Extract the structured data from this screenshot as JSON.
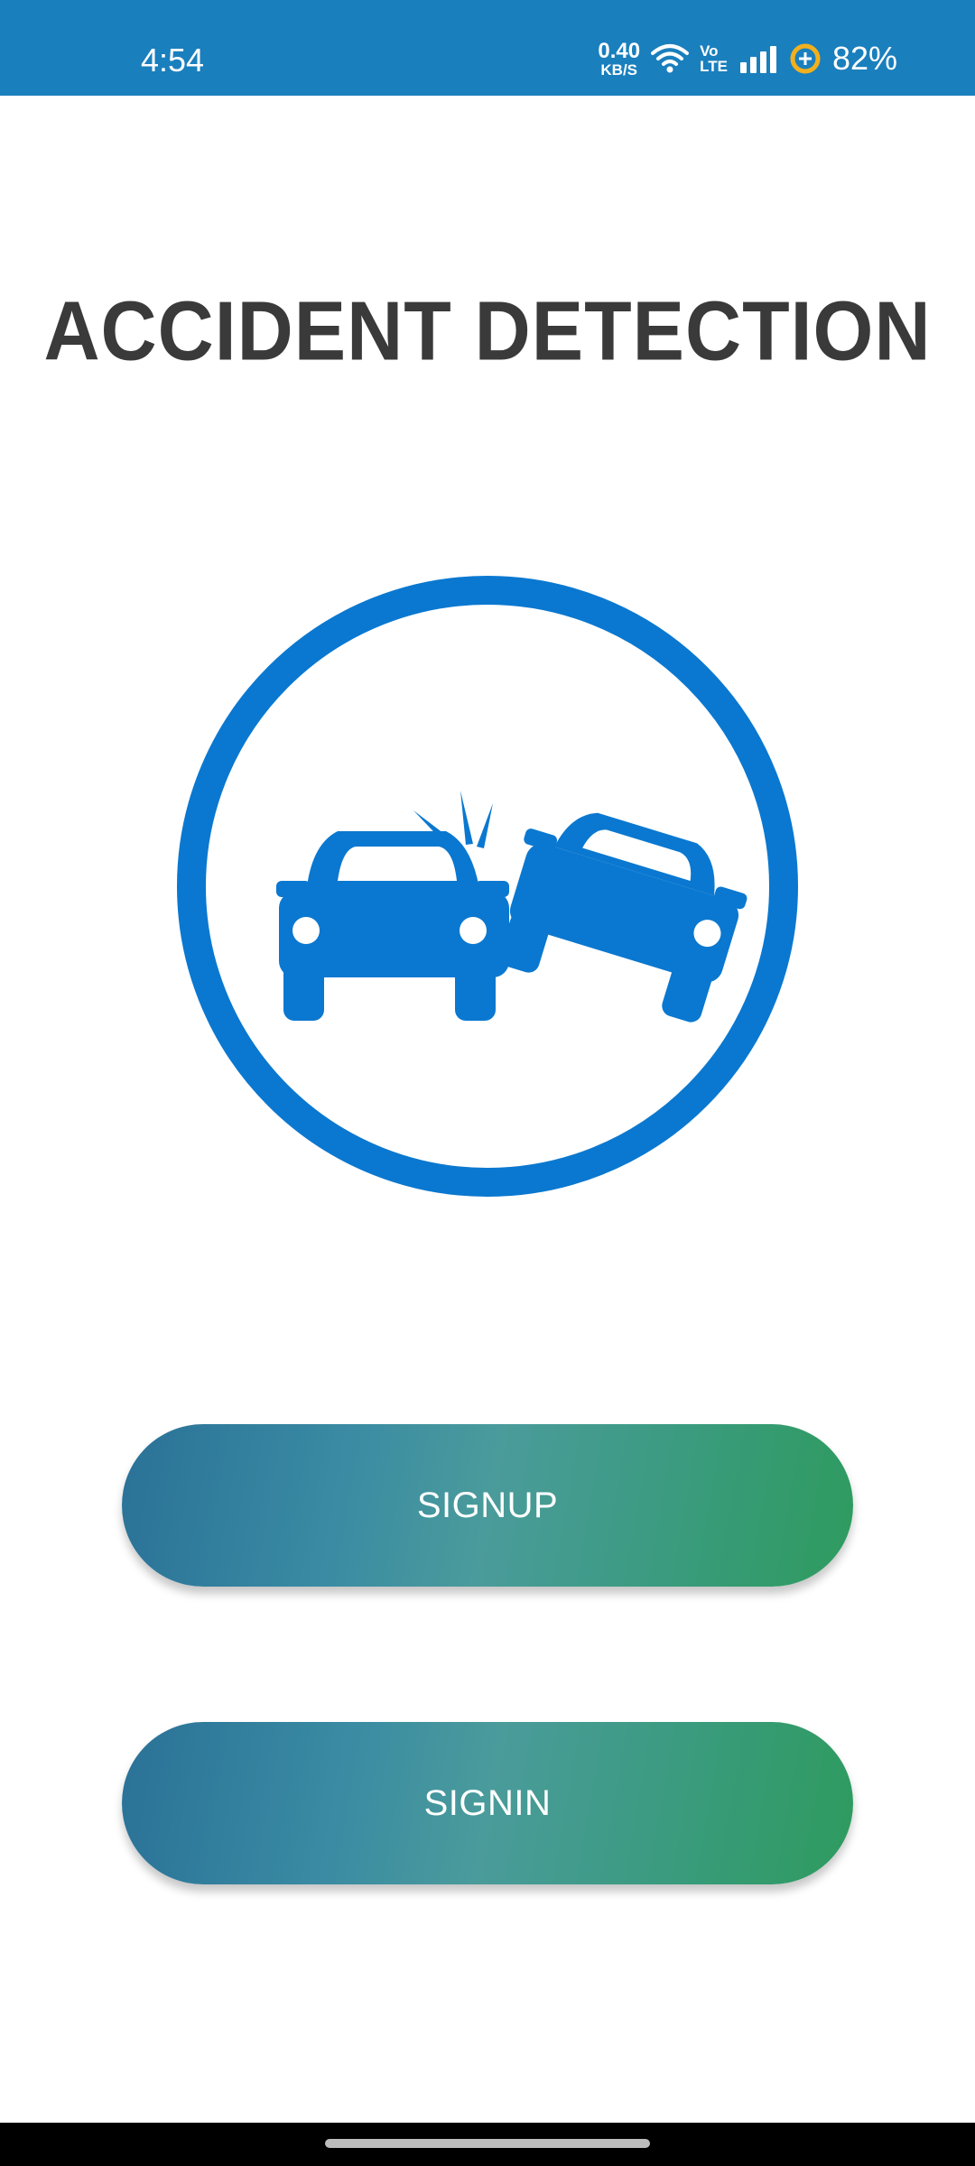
{
  "status_bar": {
    "time": "4:54",
    "net_speed_value": "0.40",
    "net_speed_unit": "KB/S",
    "volte_top": "Vo",
    "volte_bottom": "LTE",
    "battery": "82%"
  },
  "main": {
    "title": "ACCIDENT DETECTION",
    "logo_icon": "car-crash-icon",
    "signup_label": "SIGNUP",
    "signin_label": "SIGNIN"
  },
  "colors": {
    "status_bar": "#1a7fbd",
    "logo_blue": "#0a78d0",
    "button_gradient_start": "#2a7197",
    "button_gradient_end": "#2e9b5e",
    "title_text": "#3a3a3a"
  }
}
